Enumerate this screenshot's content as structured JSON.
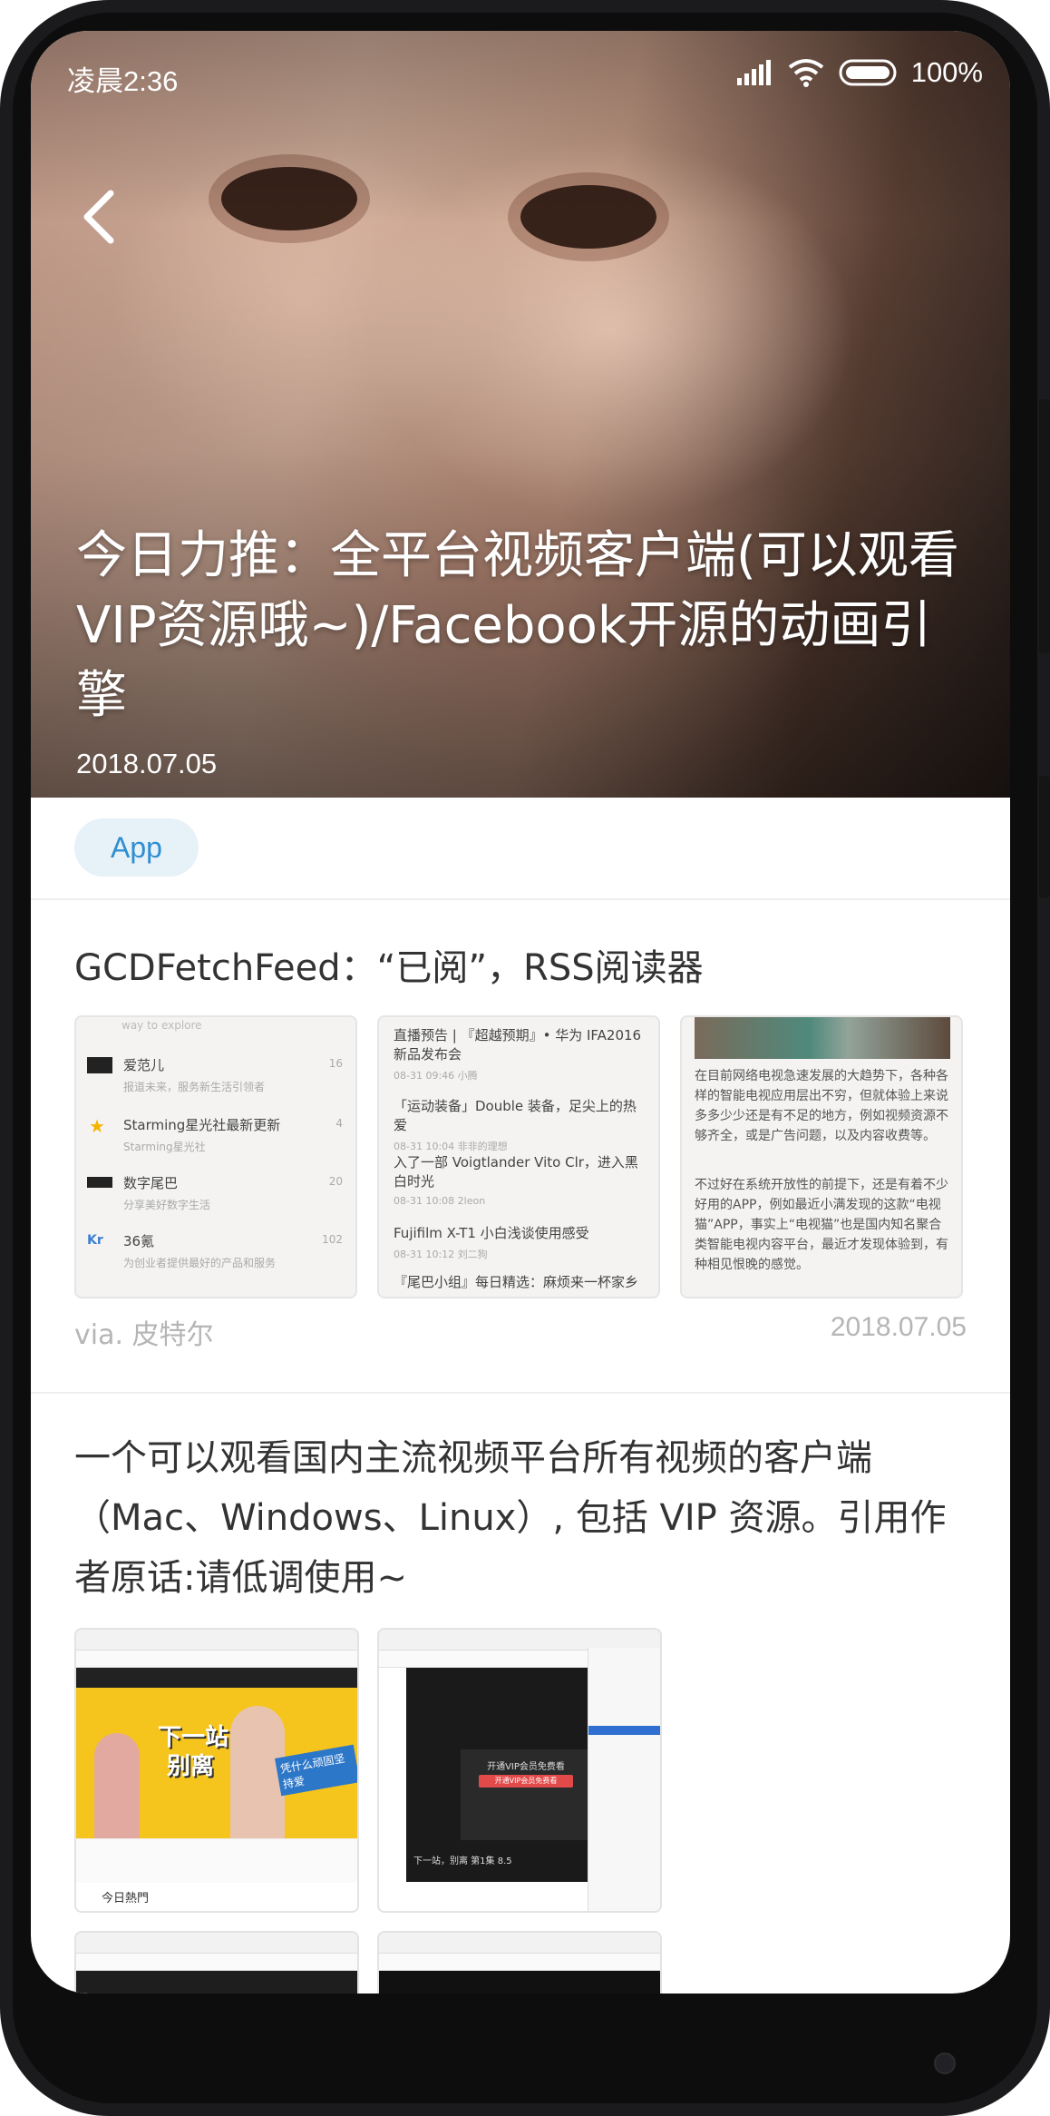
{
  "status_bar": {
    "time": "凌晨2:36",
    "battery": "100%",
    "icons": [
      "signal-icon",
      "wifi-icon",
      "battery-icon"
    ]
  },
  "header": {
    "back_icon": "chevron-left-icon",
    "title": "今日力推：全平台视频客户端(可以观看VIP资源哦~)/Facebook开源的动画引擎",
    "date": "2018.07.05"
  },
  "tag": "App",
  "article": {
    "title": "GCDFetchFeed：“已阅”，RSS阅读器",
    "via": "via. 皮特尔",
    "date": "2018.07.05",
    "paragraph": "一个可以观看国内主流视频平台所有视频的客户端（Mac、Windows、Linux）, 包括 VIP 资源。引用作者原话:请低调使用~"
  },
  "thumb1": {
    "header": "way to explore",
    "items": [
      {
        "name": "爱范儿",
        "sub": "报道未来，服务新生活引领者",
        "count": "16"
      },
      {
        "name": "Starming星光社最新更新",
        "sub": "Starming星光社",
        "count": "4"
      },
      {
        "name": "数字尾巴",
        "sub": "分享美好数字生活",
        "count": "20"
      },
      {
        "name": "36氪",
        "sub": "为创业者提供最好的产品和服务",
        "count": "102"
      }
    ]
  },
  "thumb2": {
    "items": [
      {
        "title": "直播预告 | 『超越预期』• 华为 IFA2016 新品发布会",
        "meta": "08-31 09:46  小腾"
      },
      {
        "title": "「运动装备」Double 装备，足尖上的热爱",
        "meta": "08-31 10:04  非非的理想"
      },
      {
        "title": "入了一部 Voigtlander Vito Clr，进入黑白时光",
        "meta": "08-31 10:08  2leon"
      },
      {
        "title": "Fujifilm X-T1 小白浅谈使用感受",
        "meta": "08-31 10:12  刘二狗"
      },
      {
        "title": "『尾巴小组』每日精选：麻烦来一杯家乡",
        "meta": ""
      }
    ]
  },
  "thumb3": {
    "text1": "在目前网络电视急速发展的大趋势下，各种各样的智能电视应用层出不穷，但就体验上来说多多少少还是有不足的地方，例如视频资源不够齐全，或是广告问题，以及内容收费等。",
    "text2": "不过好在系统开放性的前提下，还是有着不少好用的APP，例如最近小满发现的这款“电视猫”APP，事实上“电视猫”也是国内知名聚合类智能电视内容平台，最近才发现体验到，有种相见恨晚的感觉。"
  },
  "shot1": {
    "banner_big": "下一站，",
    "banner_big2": "别离",
    "banner_side": "凭什么顽固坚持爱",
    "section": "今日熱門"
  },
  "shot2": {
    "title": "下一站，别离 第1集 8.5",
    "overlay": "开通VIP会员免费看",
    "overlay_btn": "开通VIP会员免费看"
  }
}
